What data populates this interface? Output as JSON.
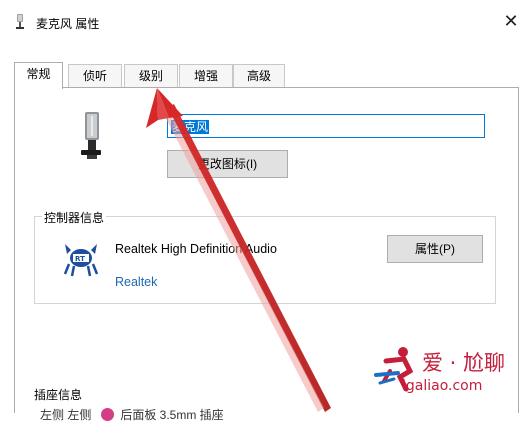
{
  "window": {
    "title": "麦克风 属性",
    "close_glyph": "✕",
    "title_icon": "microphone-small-icon"
  },
  "tabs": [
    {
      "label": "常规",
      "active": true
    },
    {
      "label": "侦听",
      "active": false
    },
    {
      "label": "级别",
      "active": false
    },
    {
      "label": "增强",
      "active": false
    },
    {
      "label": "高级",
      "active": false
    }
  ],
  "general": {
    "device_icon": "microphone-icon",
    "name_value": "麦克风",
    "change_icon_button": "更改图标(I)"
  },
  "controller": {
    "legend": "控制器信息",
    "logo": "realtek-crab-logo",
    "device_name": "Realtek High Definition Audio",
    "vendor": "Realtek",
    "properties_button": "属性(P)",
    "vendor_color": "#1f67b1"
  },
  "jack": {
    "legend": "插座信息",
    "row_prefix": "左侧 左侧",
    "row_jack": "后面板 3.5mm 插座",
    "dot_color": "#d43d85"
  },
  "annotation": {
    "arrow_color": "#d62828",
    "points_to": "tab-level"
  },
  "watermark": {
    "logo": "runner-logo",
    "text": "爱 · 尬聊",
    "url": "igaliao.com",
    "color": "#c41e3a"
  }
}
